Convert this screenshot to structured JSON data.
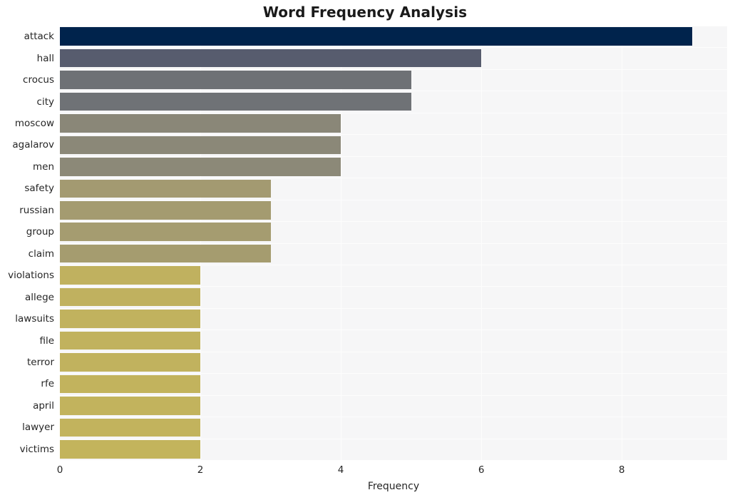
{
  "chart_data": {
    "type": "bar",
    "orientation": "horizontal",
    "title": "Word Frequency Analysis",
    "xlabel": "Frequency",
    "ylabel": "",
    "categories": [
      "attack",
      "hall",
      "crocus",
      "city",
      "moscow",
      "agalarov",
      "men",
      "safety",
      "russian",
      "group",
      "claim",
      "violations",
      "allege",
      "lawsuits",
      "file",
      "terror",
      "rfe",
      "april",
      "lawyer",
      "victims"
    ],
    "values": [
      9,
      6,
      5,
      5,
      4,
      4,
      4,
      3,
      3,
      3,
      3,
      2,
      2,
      2,
      2,
      2,
      2,
      2,
      2,
      2
    ],
    "xlim": [
      0,
      9.5
    ],
    "xticks": [
      0,
      2,
      4,
      6,
      8
    ],
    "xtick_labels": [
      "0",
      "2",
      "4",
      "6",
      "8"
    ],
    "grid": true,
    "legend": false,
    "colormap": "cividis",
    "bar_colors": [
      "#00234c",
      "#575c6e",
      "#6e7175",
      "#6f7276",
      "#8a8778",
      "#8b8878",
      "#8c8978",
      "#a39a71",
      "#a49b70",
      "#a59c70",
      "#a59c6f",
      "#c0b15f",
      "#c0b15f",
      "#c1b25e",
      "#c1b25e",
      "#c1b25e",
      "#c2b35d",
      "#c2b35d",
      "#c2b35d",
      "#c3b45c"
    ],
    "plot_background": "#f6f6f7",
    "figure_background": "#ffffff",
    "text_color": "#262626"
  }
}
